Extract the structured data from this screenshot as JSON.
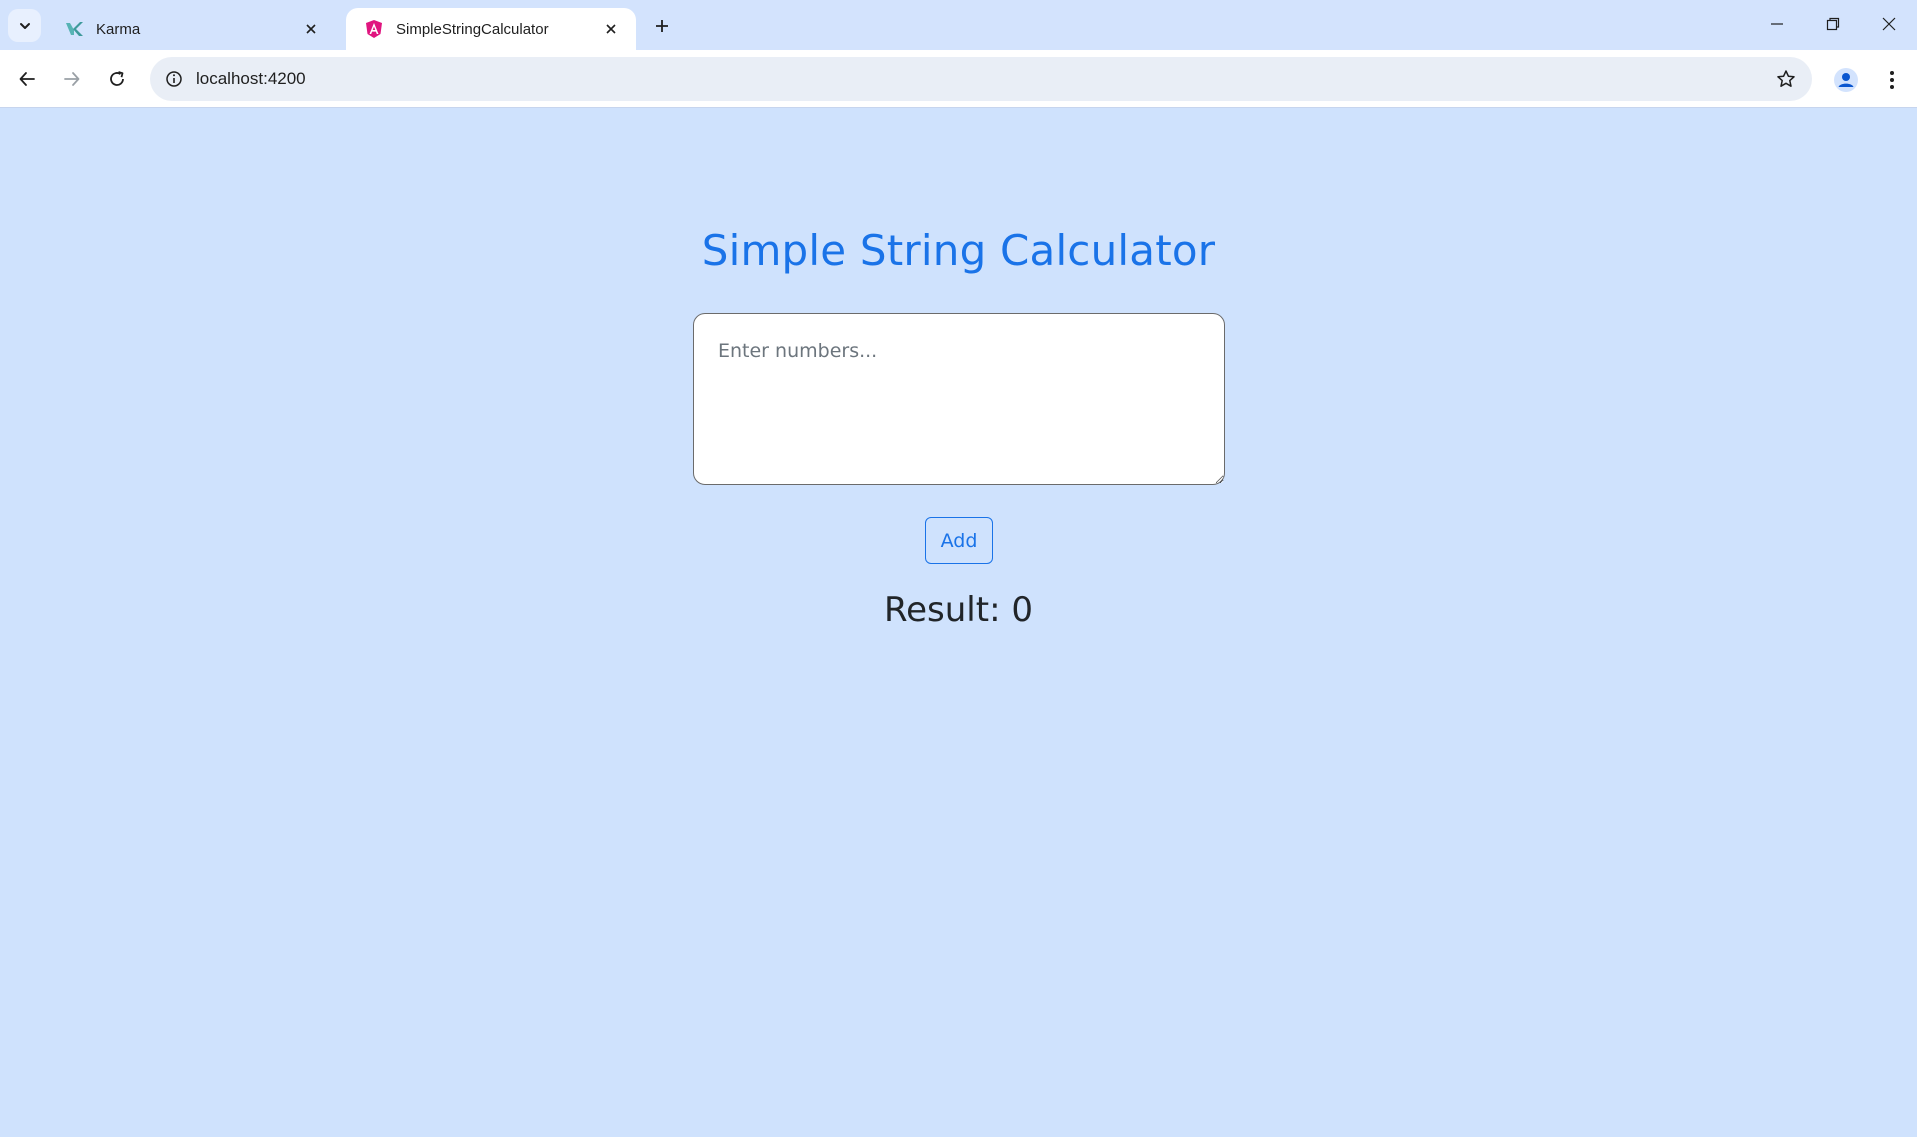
{
  "browser": {
    "tabs": [
      {
        "title": "Karma",
        "active": false,
        "favicon": "karma-icon"
      },
      {
        "title": "SimpleStringCalculator",
        "active": true,
        "favicon": "angular-icon"
      }
    ],
    "url": "localhost:4200"
  },
  "page": {
    "title": "Simple String Calculator",
    "input_placeholder": "Enter numbers...",
    "input_value": "",
    "add_label": "Add",
    "result_label": "Result:",
    "result_value": "0"
  },
  "colors": {
    "page_background": "#cfe2fd",
    "accent": "#1a73e8",
    "text": "#212529"
  }
}
